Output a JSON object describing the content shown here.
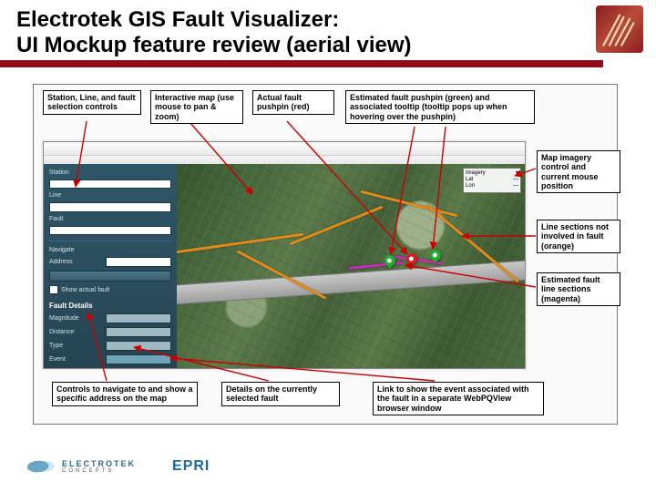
{
  "title_line1": "Electrotek GIS Fault Visualizer:",
  "title_line2": "UI Mockup feature review (aerial view)",
  "callouts": {
    "top1": "Station, Line, and fault selection controls",
    "top2": "Interactive map (use mouse to pan & zoom)",
    "top3": "Actual fault pushpin (red)",
    "top4": "Estimated fault pushpin (green) and associated tooltip (tooltip pops up when hovering over the pushpin)",
    "right1": "Map imagery control and current mouse position",
    "right2": "Line sections not involved in fault (orange)",
    "right3": "Estimated fault line sections (magenta)",
    "bottom1": "Controls to navigate to and show a specific address on the map",
    "bottom2": "Details on the currently selected fault",
    "bottom3": "Link to show the event associated with the fault in a separate WebPQView browser window"
  },
  "sidebar": {
    "station_label": "Station",
    "line_label": "Line",
    "fault_label": "Fault",
    "navigate_label": "Navigate",
    "address_label": "Address",
    "show_fault_label": "Show actual fault",
    "details_title": "Fault Details",
    "detail_rows": [
      {
        "label": "Magnitude"
      },
      {
        "label": "Distance"
      },
      {
        "label": "Type"
      },
      {
        "label": "Event"
      }
    ]
  },
  "map_ctrl": {
    "imagery_label": "Imagery",
    "lat_label": "Lat",
    "lon_label": "Lon"
  },
  "footer": {
    "electrotek_name": "ELECTROTEK",
    "electrotek_sub": "CONCEPTS",
    "epri": "EPRI"
  }
}
